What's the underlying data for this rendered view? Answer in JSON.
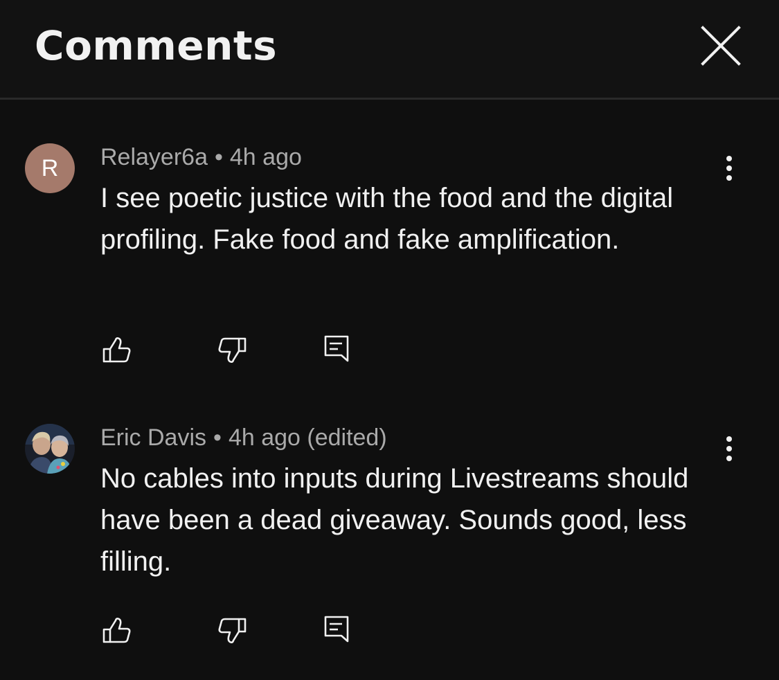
{
  "header": {
    "title": "Comments",
    "close_icon": "close-icon"
  },
  "comments": [
    {
      "avatar_letter": "R",
      "avatar_color": "#a57a6b",
      "author": "Relayer6a",
      "separator": "•",
      "time": "4h ago",
      "text": "I see poetic justice with the food and the digital profiling. Fake food and fake amplification."
    },
    {
      "avatar_type": "photo",
      "author": "Eric Davis",
      "separator": "•",
      "time": "4h ago (edited)",
      "text": "No cables into inputs during Livestreams should have been a dead giveaway. Sounds good, less filling."
    }
  ],
  "icons": {
    "like": "thumbs-up-icon",
    "dislike": "thumbs-down-icon",
    "reply": "reply-icon",
    "more": "more-vertical-icon"
  },
  "colors": {
    "background": "#0f0f0f",
    "header_bg": "#121212",
    "text_primary": "#f1f1f1",
    "text_secondary": "#aaaaaa"
  }
}
